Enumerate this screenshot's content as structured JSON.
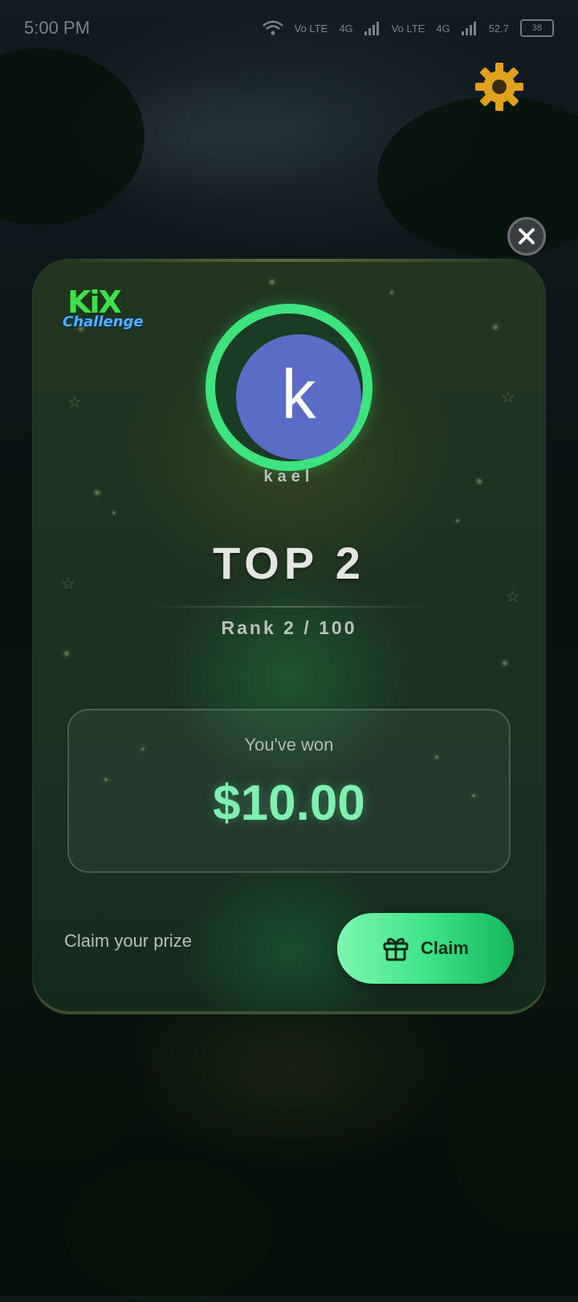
{
  "status_bar": {
    "time": "5:00 PM",
    "net1": "Vo LTE",
    "net2": "Vo LTE",
    "lte1": "4G",
    "lte2": "4G",
    "speed": "52.7",
    "battery": "38"
  },
  "card": {
    "logo_main": "KiX",
    "logo_sub": "Challenge",
    "avatar_letter": "k",
    "username": "kael",
    "rank_title": "TOP 2",
    "rank_detail": "Rank 2 / 100",
    "prize_label": "You've won",
    "prize_amount": "$10.00",
    "claim_prompt": "Claim your prize",
    "claim_button": "Claim"
  },
  "colors": {
    "accent_green": "#3de37f",
    "avatar_bg": "#5b6cc6",
    "prize_text": "#7ff0b0"
  },
  "icons": [
    "settings-gear-icon",
    "close-icon",
    "gift-icon",
    "wifi-icon",
    "signal-icon",
    "battery-icon"
  ]
}
